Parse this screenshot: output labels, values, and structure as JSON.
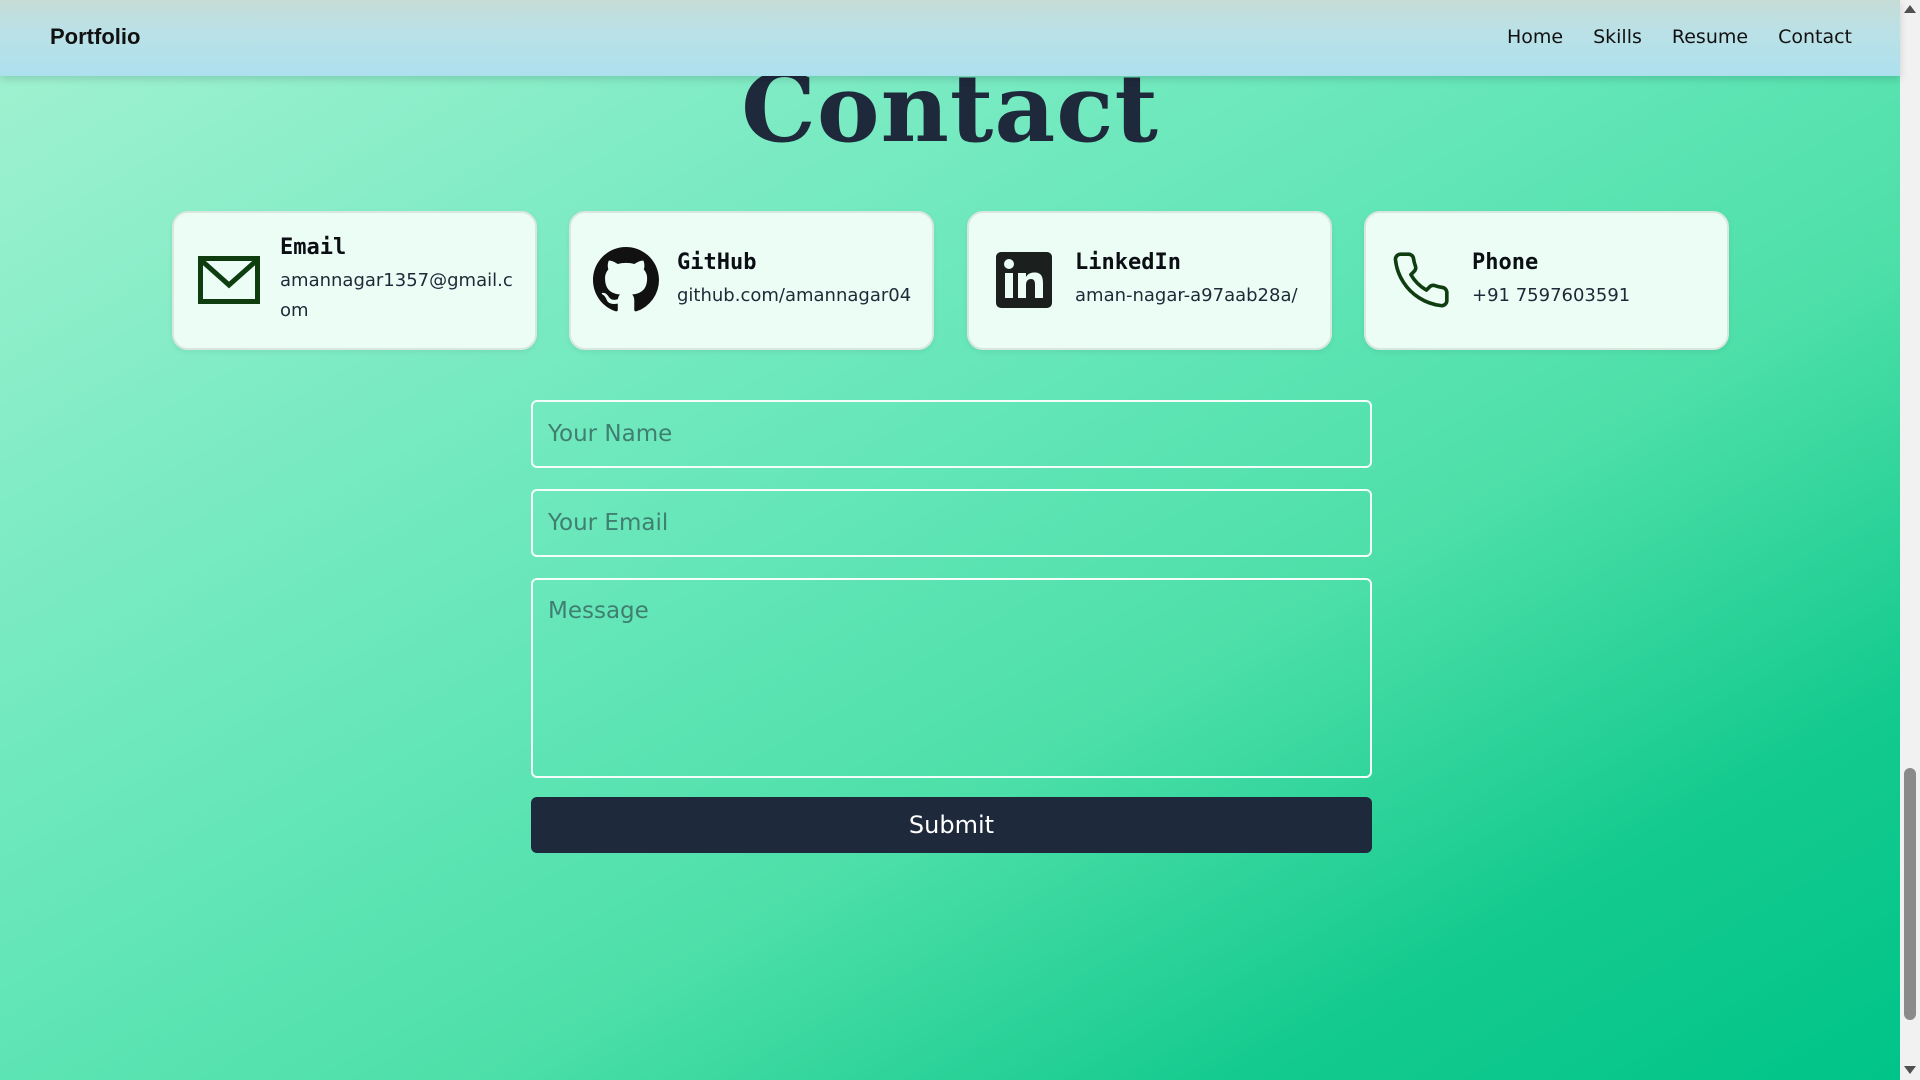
{
  "navbar": {
    "brand": "Portfolio",
    "links": [
      "Home",
      "Skills",
      "Resume",
      "Contact"
    ]
  },
  "heading": "Contact",
  "cards": [
    {
      "icon": "email-envelope-icon",
      "title": "Email",
      "value": "amannagar1357@gmail.com"
    },
    {
      "icon": "github-icon",
      "title": "GitHub",
      "value": "github.com/amannagar04"
    },
    {
      "icon": "linkedin-icon",
      "title": "LinkedIn",
      "value": "aman-nagar-a97aab28a/"
    },
    {
      "icon": "phone-icon",
      "title": "Phone",
      "value": "+91 7597603591"
    }
  ],
  "form": {
    "name_placeholder": "Your Name",
    "email_placeholder": "Your Email",
    "message_placeholder": "Message",
    "name_value": "",
    "email_value": "",
    "message_value": "",
    "submit_label": "Submit"
  },
  "colors": {
    "heading": "#1e293b",
    "button": "#1e293b",
    "card_bg": "#ecfdf5",
    "icon_dark_green": "#0f3d10"
  }
}
